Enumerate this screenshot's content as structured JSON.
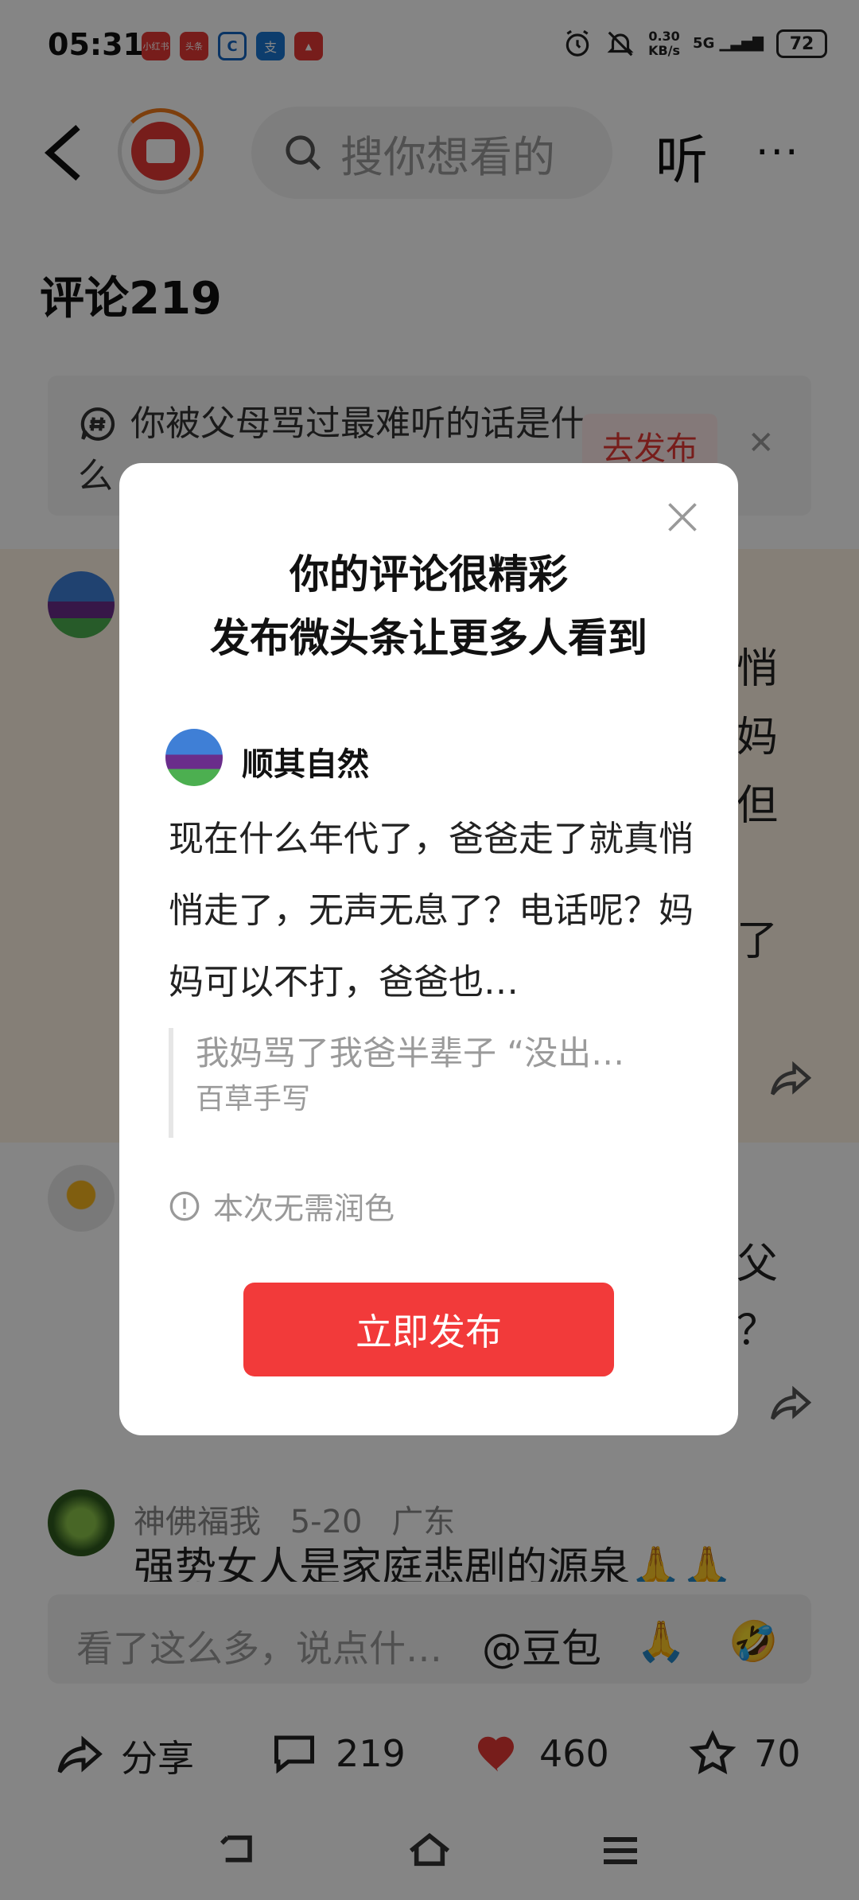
{
  "status_bar": {
    "time": "05:31",
    "apps": [
      "小红书",
      "头条",
      "C",
      "支",
      "▲"
    ],
    "net_speed": "0.30",
    "net_unit": "KB/s",
    "signal": "5G",
    "battery": "72"
  },
  "header": {
    "search_placeholder": "搜你想看的",
    "listen_label": "听",
    "more_label": "···"
  },
  "comments_section": {
    "title": "评论219"
  },
  "topic_banner": {
    "text": "你被父母骂过最难听的话是什么",
    "button": "去发布"
  },
  "background_comments": {
    "c1_peek": [
      "悄",
      "妈",
      "但",
      "了"
    ],
    "c2_peek": [
      "父",
      "？"
    ],
    "c3_author": "神佛福我",
    "c3_date": "5-20",
    "c3_location": "广东",
    "c3_text": "强势女人是家庭悲剧的源泉🙏🙏"
  },
  "input_bar": {
    "placeholder": "看了这么多，说点什…",
    "mention": "@豆包",
    "emoji1": "🙏",
    "emoji2": "🤣"
  },
  "actions": {
    "share": "分享",
    "comments": "219",
    "likes": "460",
    "favorites": "70"
  },
  "modal": {
    "title_line1": "你的评论很精彩",
    "title_line2": "发布微头条让更多人看到",
    "username": "顺其自然",
    "body": "现在什么年代了，爸爸走了就真悄悄走了，无声无息了？电话呢？妈妈可以不打，爸爸也…",
    "quote_text": "我妈骂了我爸半辈子 “没出…",
    "quote_source": "百草手写",
    "note": "本次无需润色",
    "publish_button": "立即发布"
  }
}
